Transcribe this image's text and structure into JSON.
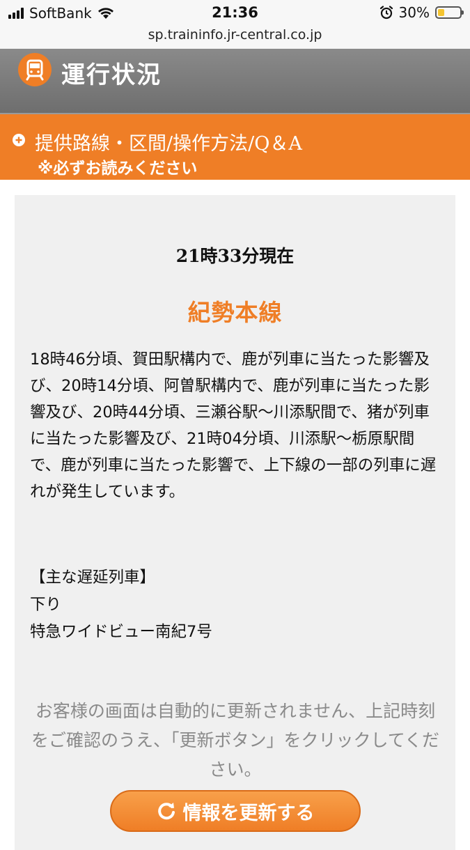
{
  "status_bar": {
    "carrier": "SoftBank",
    "time": "21:36",
    "battery_percent": "30%",
    "battery_level": 0.3,
    "icons": [
      "signal-icon",
      "wifi-icon",
      "alarm-icon",
      "battery-icon"
    ]
  },
  "browser": {
    "url": "sp.traininfo.jr-central.co.jp"
  },
  "header": {
    "title": "運行状況",
    "icon": "train-icon"
  },
  "info_bar": {
    "link_label": "提供路線・区間/操作方法/Q＆A",
    "note": "※必ずお読みください",
    "icon": "plus-circle-icon"
  },
  "main": {
    "timestamp": "21時33分現在",
    "line_name": "紀勢本線",
    "message": "18時46分頃、賀田駅構内で、鹿が列車に当たった影響及び、20時14分頃、阿曽駅構内で、鹿が列車に当たった影響及び、20時44分頃、三瀬谷駅〜川添駅間で、猪が列車に当たった影響及び、21時04分頃、川添駅〜栃原駅間で、鹿が列車に当たった影響で、上下線の一部の列車に遅れが発生しています。",
    "delayed_heading": "【主な遅延列車】",
    "direction": "下り",
    "train": "特急ワイドビュー南紀7号",
    "notice": "お客様の画面は自動的に更新されません、上記時刻をご確認のうえ、「更新ボタン」をクリックしてください。",
    "refresh_button": "情報を更新する"
  },
  "colors": {
    "accent": "#ef7e26",
    "header_bg": "#7a7a7a",
    "panel_bg": "#f0f0f0",
    "notice_text": "#8a8a8a"
  }
}
